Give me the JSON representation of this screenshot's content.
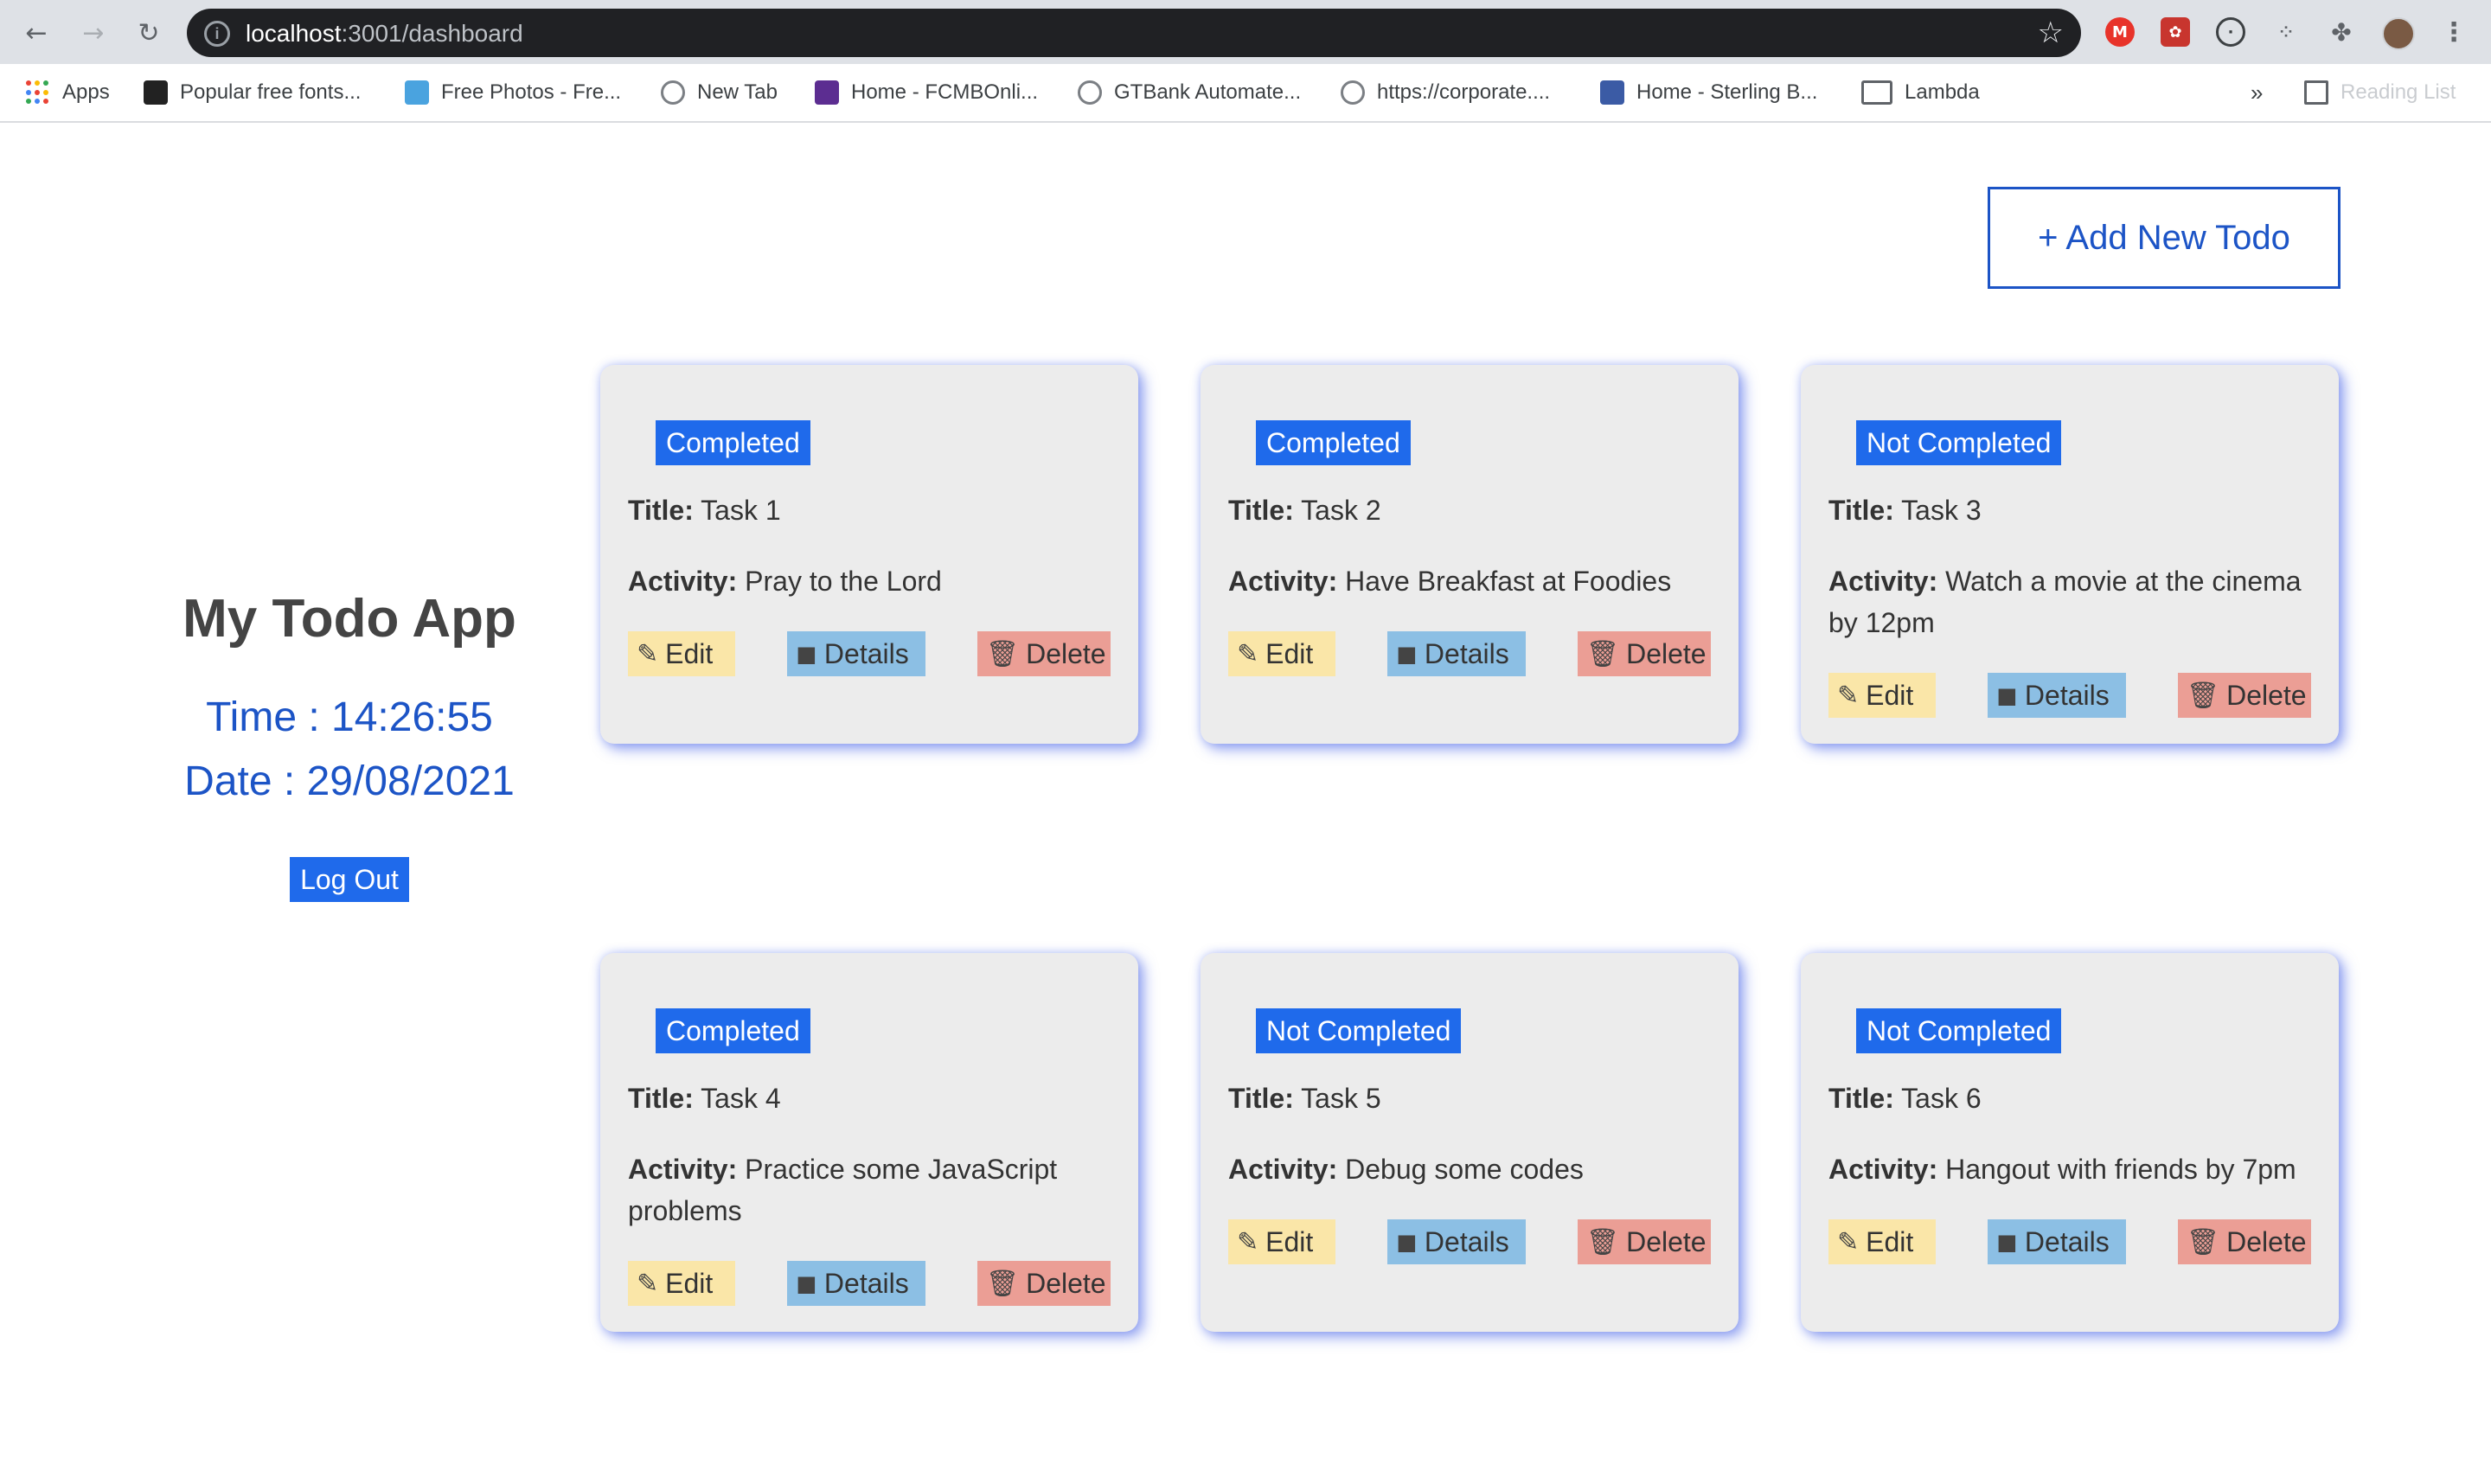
{
  "browser": {
    "url_host": "localhost",
    "url_path": ":3001/dashboard",
    "reading_list_label": "Reading List",
    "overflow_label": "»",
    "bookmarks": [
      {
        "label": "Apps",
        "icon": "apps-grid-icon"
      },
      {
        "label": "Popular free fonts...",
        "icon": "fontsquirrel-icon"
      },
      {
        "label": "Free Photos - Fre...",
        "icon": "pexels-icon"
      },
      {
        "label": "New Tab",
        "icon": "globe-icon"
      },
      {
        "label": "Home - FCMBOnli...",
        "icon": "fcmb-icon"
      },
      {
        "label": "GTBank Automate...",
        "icon": "globe-icon"
      },
      {
        "label": "https://corporate....",
        "icon": "globe-icon"
      },
      {
        "label": "Home - Sterling B...",
        "icon": "sterling-icon"
      },
      {
        "label": "Lambda",
        "icon": "folder-icon"
      }
    ]
  },
  "header": {
    "add_button_label": "+ Add New Todo"
  },
  "sidebar": {
    "app_title": "My Todo App",
    "time": "Time : 14:26:55",
    "date": "Date : 29/08/2021",
    "logout_label": "Log Out"
  },
  "labels": {
    "title": "Title:",
    "activity": "Activity:",
    "edit": "Edit",
    "details": "Details",
    "delete": "Delete"
  },
  "todos": [
    {
      "status": "Completed",
      "title": "Task 1",
      "activity": "Pray to the Lord"
    },
    {
      "status": "Completed",
      "title": "Task 2",
      "activity": "Have Breakfast at Foodies"
    },
    {
      "status": "Not Completed",
      "title": "Task 3",
      "activity": "Watch a movie at the cinema by 12pm"
    },
    {
      "status": "Completed",
      "title": "Task 4",
      "activity": "Practice some JavaScript problems"
    },
    {
      "status": "Not Completed",
      "title": "Task 5",
      "activity": "Debug some codes"
    },
    {
      "status": "Not Completed",
      "title": "Task 6",
      "activity": "Hangout with friends by 7pm"
    }
  ],
  "colors": {
    "primary": "#1f6aeb",
    "primary_text": "#1c54c6",
    "card_bg": "#ececec",
    "edit_bg": "#fae6a8",
    "details_bg": "#8cbfe4",
    "delete_bg": "#eb9e95"
  }
}
